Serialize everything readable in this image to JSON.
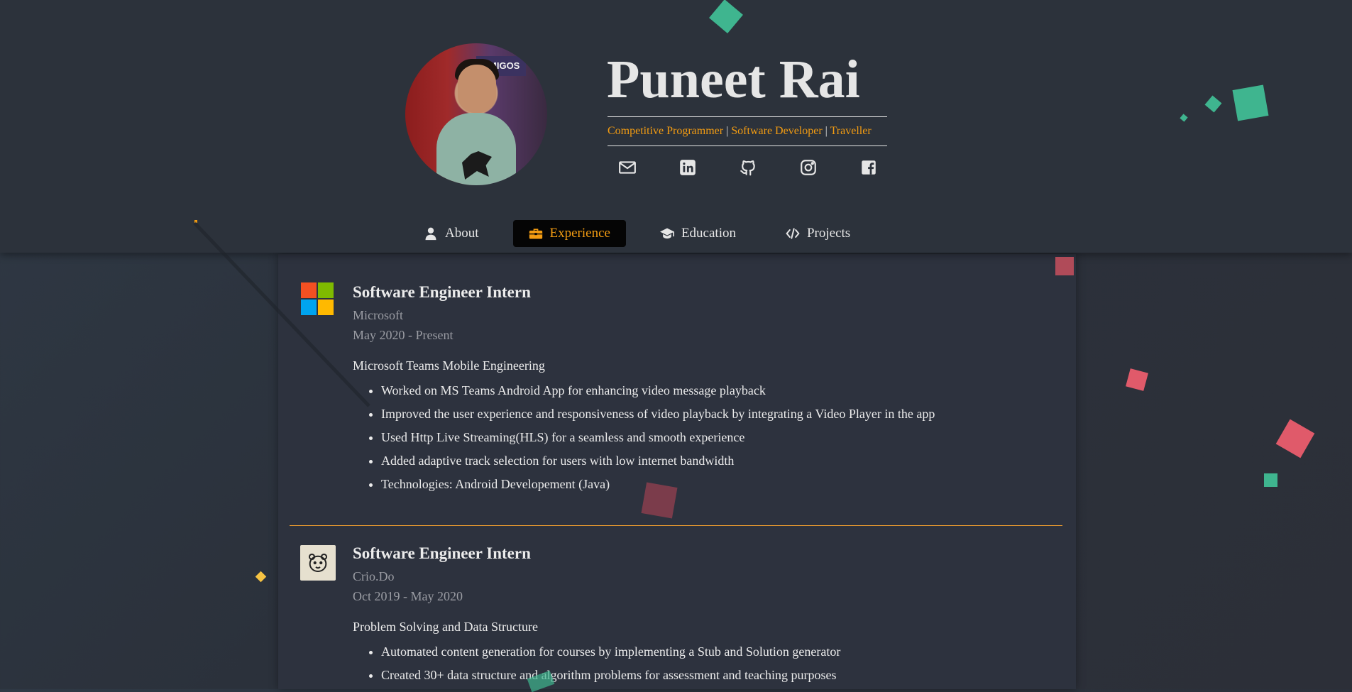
{
  "profile": {
    "name": "Puneet Rai",
    "roles": [
      "Competitive Programmer",
      "Software Developer",
      "Traveller"
    ],
    "separator": "|",
    "avatar_sign": "AMIGOS"
  },
  "socials": [
    {
      "icon": "email-icon"
    },
    {
      "icon": "linkedin-icon"
    },
    {
      "icon": "github-icon"
    },
    {
      "icon": "instagram-icon"
    },
    {
      "icon": "facebook-icon"
    }
  ],
  "nav": {
    "about": "About",
    "experience": "Experience",
    "education": "Education",
    "projects": "Projects",
    "active": "experience"
  },
  "experience": [
    {
      "title": "Software Engineer Intern",
      "company": "Microsoft",
      "dates": "May 2020 - Present",
      "summary": "Microsoft Teams Mobile Engineering",
      "bullets": [
        "Worked on MS Teams Android App for enhancing video message playback",
        "Improved the user experience and responsiveness of video playback by integrating a Video Player in the app",
        "Used Http Live Streaming(HLS) for a seamless and smooth experience",
        "Added adaptive track selection for users with low internet bandwidth",
        "Technologies: Android Developement (Java)"
      ]
    },
    {
      "title": "Software Engineer Intern",
      "company": "Crio.Do",
      "dates": "Oct 2019 - May 2020",
      "summary": "Problem Solving and Data Structure",
      "bullets": [
        "Automated content generation for courses by implementing a Stub and Solution generator",
        "Created 30+ data structure and algorithm problems for assessment and teaching purposes"
      ]
    }
  ],
  "colors": {
    "accent": "#f39c12",
    "confetti_green": "#3fb58f",
    "confetti_red": "#e05a6a",
    "confetti_yellow": "#f6c343"
  }
}
